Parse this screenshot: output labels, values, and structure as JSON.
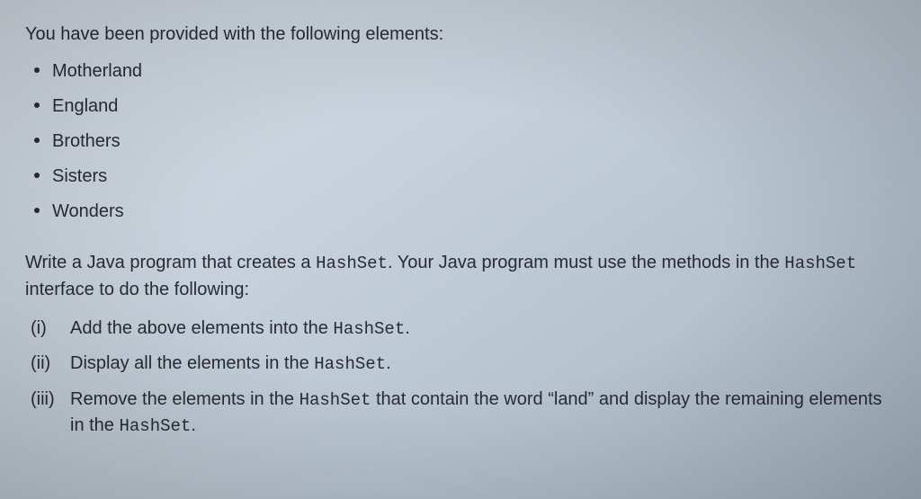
{
  "intro": "You have been provided with the following elements:",
  "elements": [
    "Motherland",
    "England",
    "Brothers",
    "Sisters",
    "Wonders"
  ],
  "instruction_pre": "Write a Java program that creates a ",
  "instruction_code1": "HashSet",
  "instruction_mid": ". Your Java program must use the methods in the ",
  "instruction_code2": "HashSet",
  "instruction_post": " interface to do the following:",
  "tasks": [
    {
      "num": "(i)",
      "pre": "Add the above elements into the ",
      "code": "HashSet",
      "post": "."
    },
    {
      "num": "(ii)",
      "pre": "Display all the elements in the ",
      "code": "HashSet",
      "post": "."
    },
    {
      "num": "(iii)",
      "pre": "Remove the elements in the ",
      "code": "HashSet",
      "post": "  that contain the word “land” and display the remaining elements in the ",
      "code2": "HashSet",
      "post2": "."
    }
  ]
}
